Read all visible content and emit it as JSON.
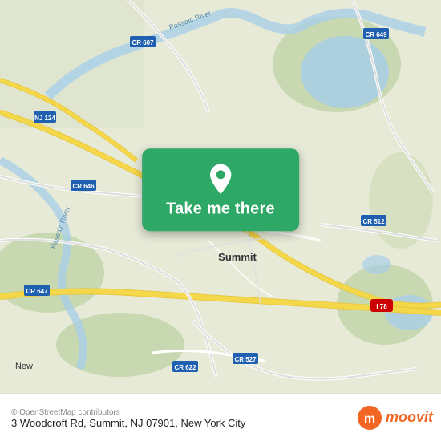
{
  "map": {
    "center_lat": 40.7163,
    "center_lng": -74.3604,
    "zoom_label": "Summit, NJ area"
  },
  "cta": {
    "button_label": "Take me there",
    "pin_alt": "location pin"
  },
  "bottom_bar": {
    "address": "3 Woodcroft Rd, Summit, NJ 07901, New York City",
    "attribution": "© OpenStreetMap contributors",
    "logo_text": "moovit"
  },
  "road_labels": {
    "cr607": "CR 607",
    "cr649": "CR 649",
    "cr646": "CR 646",
    "nj124": "NJ 124",
    "cr647": "CR 647",
    "cr527": "CR 527",
    "cr622": "CR 622",
    "cr512": "CR 512",
    "i78": "I 78",
    "summit": "Summit",
    "passaic_river": "Passaic River"
  }
}
